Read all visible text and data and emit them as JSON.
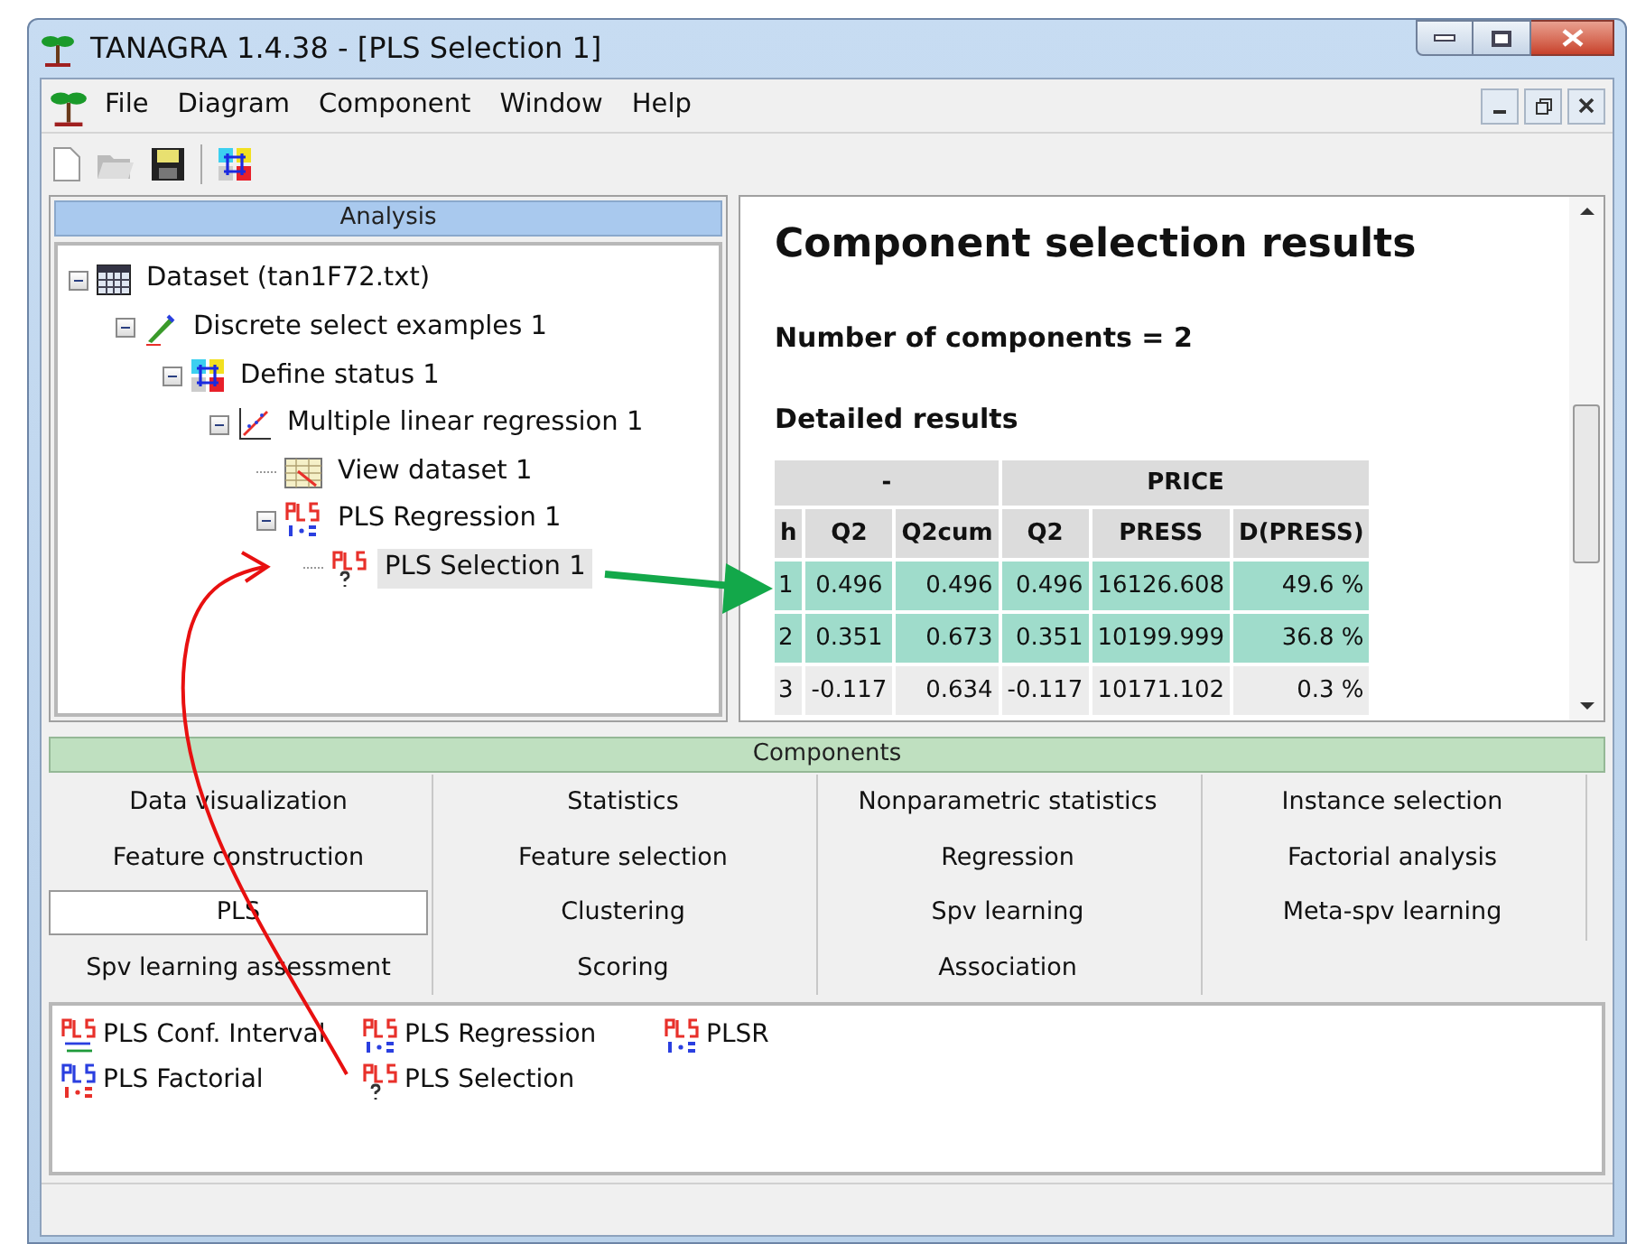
{
  "window": {
    "title": "TANAGRA 1.4.38 - [PLS Selection 1]"
  },
  "menu": [
    "File",
    "Diagram",
    "Component",
    "Window",
    "Help"
  ],
  "analysis": {
    "title": "Analysis",
    "tree": [
      {
        "label": "Dataset (tan1F72.txt)",
        "kind": "dataset",
        "selected": false,
        "expanded": true,
        "children": [
          {
            "label": "Discrete select examples 1",
            "kind": "select",
            "selected": false,
            "expanded": true,
            "children": [
              {
                "label": "Define status 1",
                "kind": "status",
                "selected": false,
                "expanded": true,
                "children": [
                  {
                    "label": "Multiple linear regression 1",
                    "kind": "regression",
                    "selected": false,
                    "expanded": true,
                    "children": [
                      {
                        "label": "View dataset 1",
                        "kind": "view",
                        "selected": false
                      },
                      {
                        "label": "PLS Regression 1",
                        "kind": "pls",
                        "selected": false,
                        "expanded": true,
                        "children": [
                          {
                            "label": "PLS Selection 1",
                            "kind": "pls-select",
                            "selected": true
                          }
                        ]
                      }
                    ]
                  }
                ]
              }
            ]
          }
        ]
      }
    ]
  },
  "results": {
    "title": "Component selection results",
    "summary": "Number of components = 2",
    "subtitle": "Detailed results",
    "table": {
      "groups": [
        {
          "label": "-",
          "columns": [
            "h",
            "Q2",
            "Q2cum"
          ]
        },
        {
          "label": "PRICE",
          "columns": [
            "Q2",
            "PRESS",
            "D(PRESS)"
          ]
        }
      ],
      "rows": [
        {
          "cells": [
            "1",
            "0.496",
            "0.496",
            "0.496",
            "16126.608",
            "49.6 %"
          ],
          "highlighted": true
        },
        {
          "cells": [
            "2",
            "0.351",
            "0.673",
            "0.351",
            "10199.999",
            "36.8 %"
          ],
          "highlighted": true
        },
        {
          "cells": [
            "3",
            "-0.117",
            "0.634",
            "-0.117",
            "10171.102",
            "0.3 %"
          ],
          "highlighted": false
        }
      ]
    }
  },
  "components": {
    "title": "Components",
    "tabs": [
      {
        "label": "Data visualization",
        "selected": false
      },
      {
        "label": "Statistics",
        "selected": false
      },
      {
        "label": "Nonparametric statistics",
        "selected": false
      },
      {
        "label": "Instance selection",
        "selected": false
      },
      {
        "label": "Feature construction",
        "selected": false
      },
      {
        "label": "Feature selection",
        "selected": false
      },
      {
        "label": "Regression",
        "selected": false
      },
      {
        "label": "Factorial analysis",
        "selected": false
      },
      {
        "label": "PLS",
        "selected": true
      },
      {
        "label": "Clustering",
        "selected": false
      },
      {
        "label": "Spv learning",
        "selected": false
      },
      {
        "label": "Meta-spv learning",
        "selected": false
      },
      {
        "label": "Spv learning assessment",
        "selected": false
      },
      {
        "label": "Scoring",
        "selected": false
      },
      {
        "label": "Association",
        "selected": false
      }
    ],
    "items": [
      {
        "label": "PLS Conf. Interval",
        "kind": "interval"
      },
      {
        "label": "PLS Regression",
        "kind": "pls"
      },
      {
        "label": "PLSR",
        "kind": "pls"
      },
      {
        "label": "PLS Factorial",
        "kind": "factorial"
      },
      {
        "label": "PLS Selection",
        "kind": "pls-select"
      }
    ]
  }
}
